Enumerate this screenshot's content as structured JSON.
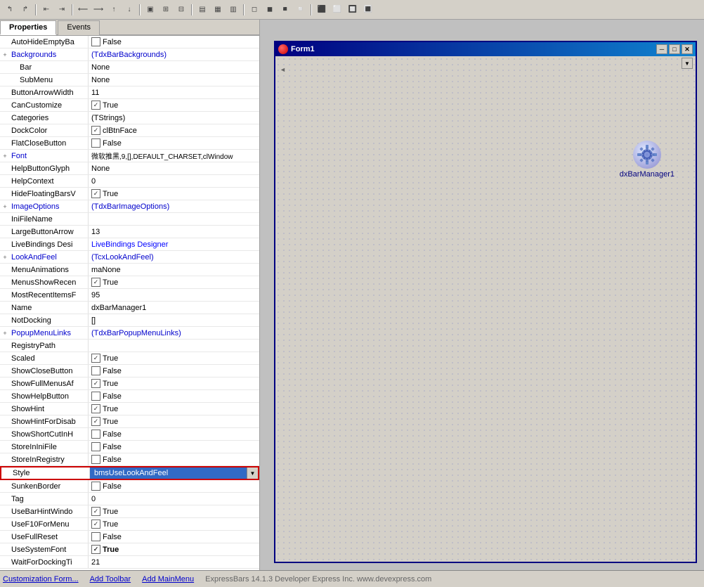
{
  "toolbar": {
    "icons": [
      "↰",
      "↱",
      "⇥",
      "←",
      "→",
      "↑",
      "↓",
      "⊞",
      "⊟",
      "▣",
      "▤",
      "▥",
      "▦",
      "▩",
      "◫",
      "◨",
      "◧",
      "⊠",
      "⊡",
      "▪",
      "▫",
      "◻",
      "◼",
      "◾",
      "◽",
      "🔲",
      "🔳"
    ]
  },
  "tabs": {
    "properties_label": "Properties",
    "events_label": "Events"
  },
  "properties": [
    {
      "id": "autohide",
      "name": "AutoHideEmptyBa",
      "type": "checkbox",
      "checked": false,
      "value": "False",
      "expandable": false
    },
    {
      "id": "backgrounds",
      "name": "Backgrounds",
      "type": "link",
      "value": "(TdxBarBackgrounds)",
      "expandable": true
    },
    {
      "id": "backgrounds_bar",
      "name": "Bar",
      "type": "text",
      "value": "None",
      "sub": true,
      "expandable": false
    },
    {
      "id": "backgrounds_submenu",
      "name": "SubMenu",
      "type": "text",
      "value": "None",
      "sub": true,
      "expandable": false
    },
    {
      "id": "buttonarrowwidth",
      "name": "ButtonArrowWidth",
      "type": "text",
      "value": "11",
      "expandable": false
    },
    {
      "id": "cancustomize",
      "name": "CanCustomize",
      "type": "checkbox",
      "checked": true,
      "value": "True",
      "expandable": false
    },
    {
      "id": "categories",
      "name": "Categories",
      "type": "text",
      "value": "(TStrings)",
      "expandable": false
    },
    {
      "id": "dockcolor",
      "name": "DockColor",
      "type": "checkbox",
      "checked": true,
      "value": "clBtnFace",
      "expandable": false
    },
    {
      "id": "flatclosebutton",
      "name": "FlatCloseButton",
      "type": "checkbox",
      "checked": false,
      "value": "False",
      "expandable": false
    },
    {
      "id": "font",
      "name": "Font",
      "type": "text",
      "value": "微软推黑,9,[],DEFAULT_CHARSET,clWindow",
      "expandable": true
    },
    {
      "id": "helpbuttonglyph",
      "name": "HelpButtonGlyph",
      "type": "text",
      "value": "None",
      "expandable": false
    },
    {
      "id": "helpcontext",
      "name": "HelpContext",
      "type": "text",
      "value": "0",
      "expandable": false
    },
    {
      "id": "hidefloatingbars",
      "name": "HideFloatingBarsV",
      "type": "checkbox",
      "checked": true,
      "value": "True",
      "expandable": false
    },
    {
      "id": "imageoptions",
      "name": "ImageOptions",
      "type": "link",
      "value": "(TdxBarImageOptions)",
      "expandable": true
    },
    {
      "id": "inifilename",
      "name": "IniFileName",
      "type": "text",
      "value": "",
      "expandable": false
    },
    {
      "id": "largebuttonarrow",
      "name": "LargeButtonArrow",
      "type": "text",
      "value": "13",
      "expandable": false
    },
    {
      "id": "livebindings",
      "name": "LiveBindings Desi",
      "type": "link",
      "value": "LiveBindings Designer",
      "expandable": false
    },
    {
      "id": "lookandfeel",
      "name": "LookAndFeel",
      "type": "link",
      "value": "(TcxLookAndFeel)",
      "expandable": true
    },
    {
      "id": "menuanimations",
      "name": "MenuAnimations",
      "type": "text",
      "value": "maNone",
      "expandable": false
    },
    {
      "id": "menusshowrecent",
      "name": "MenusShowRecen",
      "type": "checkbox",
      "checked": true,
      "value": "True",
      "expandable": false
    },
    {
      "id": "mostrecentitems",
      "name": "MostRecentItemsF",
      "type": "text",
      "value": "95",
      "expandable": false
    },
    {
      "id": "name",
      "name": "Name",
      "type": "text",
      "value": "dxBarManager1",
      "expandable": false
    },
    {
      "id": "notdocking",
      "name": "NotDocking",
      "type": "text",
      "value": "[]",
      "expandable": false
    },
    {
      "id": "popupmenulinks",
      "name": "PopupMenuLinks",
      "type": "link",
      "value": "(TdxBarPopupMenuLinks)",
      "expandable": true
    },
    {
      "id": "registrypath",
      "name": "RegistryPath",
      "type": "text",
      "value": "",
      "expandable": false
    },
    {
      "id": "scaled",
      "name": "Scaled",
      "type": "checkbox",
      "checked": true,
      "value": "True",
      "expandable": false
    },
    {
      "id": "showclosebutton",
      "name": "ShowCloseButton",
      "type": "checkbox",
      "checked": false,
      "value": "False",
      "expandable": false
    },
    {
      "id": "showfullmenus",
      "name": "ShowFullMenusAf",
      "type": "checkbox",
      "checked": true,
      "value": "True",
      "expandable": false
    },
    {
      "id": "showhelpbutton",
      "name": "ShowHelpButton",
      "type": "checkbox",
      "checked": false,
      "value": "False",
      "expandable": false
    },
    {
      "id": "showhint",
      "name": "ShowHint",
      "type": "checkbox",
      "checked": true,
      "value": "True",
      "expandable": false
    },
    {
      "id": "showhintfordis",
      "name": "ShowHintForDisab",
      "type": "checkbox",
      "checked": true,
      "value": "True",
      "expandable": false
    },
    {
      "id": "showshortcutinh",
      "name": "ShowShortCutInH",
      "type": "checkbox",
      "checked": false,
      "value": "False",
      "expandable": false
    },
    {
      "id": "storeininifile",
      "name": "StoreInIniFile",
      "type": "checkbox",
      "checked": false,
      "value": "False",
      "expandable": false
    },
    {
      "id": "storeinregistry",
      "name": "StoreInRegistry",
      "type": "checkbox",
      "checked": false,
      "value": "False",
      "expandable": false
    },
    {
      "id": "style",
      "name": "Style",
      "type": "dropdown",
      "value": "bmsUseLookAndFeel",
      "expandable": false,
      "selected": true
    },
    {
      "id": "sunkenborder",
      "name": "SunkenBorder",
      "type": "checkbox",
      "checked": false,
      "value": "False",
      "expandable": false
    },
    {
      "id": "tag",
      "name": "Tag",
      "type": "text",
      "value": "0",
      "expandable": false
    },
    {
      "id": "usebarhintwind",
      "name": "UseBarHintWindo",
      "type": "checkbox",
      "checked": true,
      "value": "True",
      "expandable": false
    },
    {
      "id": "usef10formenu",
      "name": "UseF10ForMenu",
      "type": "checkbox",
      "checked": true,
      "value": "True",
      "expandable": false
    },
    {
      "id": "usefullreset",
      "name": "UseFullReset",
      "type": "checkbox",
      "checked": false,
      "value": "False",
      "expandable": false
    },
    {
      "id": "usesystemfont",
      "name": "UseSystemFont",
      "type": "checkbox",
      "checked": true,
      "value": "True",
      "expandable": false,
      "bold": true
    },
    {
      "id": "waitfordocking",
      "name": "WaitForDockingTi",
      "type": "text",
      "value": "21",
      "expandable": false
    }
  ],
  "form": {
    "title": "Form1",
    "component_name": "dxBarManager1",
    "min_btn": "─",
    "restore_btn": "□",
    "close_btn": "✕"
  },
  "statusbar": {
    "customization_label": "Customization Form...",
    "add_toolbar_label": "Add Toolbar",
    "add_mainmenu_label": "Add MainMenu",
    "company_info": "ExpressBars 14.1.3  Developer Express Inc.  www.devexpress.com"
  }
}
